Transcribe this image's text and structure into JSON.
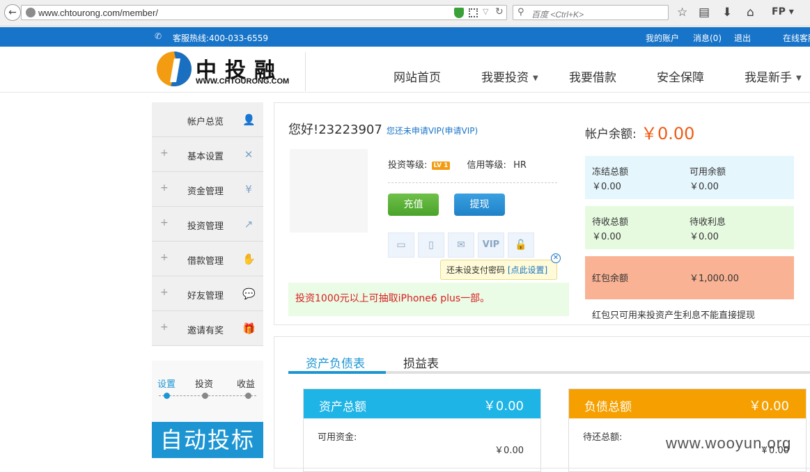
{
  "browser": {
    "url": "www.chtourong.com/member/",
    "search_placeholder": "百度 <Ctrl+K>",
    "profile": "FP"
  },
  "topbar": {
    "hotline": "客服热线:400-033-6559",
    "links": [
      "我的账户",
      "消息(0)",
      "退出",
      "在线客服"
    ]
  },
  "header": {
    "logo_text": "中投融",
    "logo_url": "WWW.CHTOURONG.COM",
    "nav": [
      "网站首页",
      "我要投资",
      "我要借款",
      "安全保障",
      "我是新手"
    ]
  },
  "sidebar": {
    "items": [
      {
        "label": "帐户总览",
        "icon": "users-icon",
        "expandable": false
      },
      {
        "label": "基本设置",
        "icon": "tools-icon",
        "expandable": true
      },
      {
        "label": "资金管理",
        "icon": "yen-icon",
        "expandable": true
      },
      {
        "label": "投资管理",
        "icon": "growth-chart-icon",
        "expandable": true
      },
      {
        "label": "借款管理",
        "icon": "hand-money-icon",
        "expandable": true
      },
      {
        "label": "好友管理",
        "icon": "chat-bubbles-icon",
        "expandable": true
      },
      {
        "label": "邀请有奖",
        "icon": "gift-icon",
        "expandable": true
      }
    ]
  },
  "auto_bid": {
    "steps": [
      "设置",
      "投资",
      "收益"
    ],
    "banner": "自动投标"
  },
  "account": {
    "greeting": "您好!23223907",
    "vip_link": "您还未申请VIP",
    "vip_apply": "(申请VIP)",
    "invest_level_label": "投资等级:",
    "invest_level_badge": "LV 1",
    "credit_level_label": "信用等级:",
    "credit_level_value": "HR",
    "recharge_label": "充值",
    "withdraw_label": "提现",
    "verify_icons": [
      "bank-card-icon",
      "mobile-phone-icon",
      "email-icon",
      "vip-icon",
      "unlock-icon"
    ],
    "vip_glyph": "VIP",
    "tooltip_text": "还未设支付密码",
    "tooltip_link": "[点此设置]",
    "promo": "投资1000元以上可抽取iPhone6 plus一部。"
  },
  "balance": {
    "label": "帐户余额:",
    "value": "￥0.00",
    "frozen_label": "冻结总额",
    "frozen_value": "￥0.00",
    "available_label": "可用余额",
    "available_value": "￥0.00",
    "pending_label": "待收总额",
    "pending_value": "￥0.00",
    "pending_interest_label": "待收利息",
    "pending_interest_value": "￥0.00",
    "redbag_label": "红包余额",
    "redbag_value": "￥1,000.00",
    "redbag_note": "红包只可用来投资产生利息不能直接提现"
  },
  "statements": {
    "tabs": [
      "资产负债表",
      "损益表"
    ],
    "assets": {
      "title": "资产总额",
      "amount": "￥0.00",
      "row_label": "可用资金:",
      "row_value": "￥0.00"
    },
    "liabilities": {
      "title": "负债总额",
      "amount": "￥0.00",
      "row_label": "待还总额:",
      "row_value": "￥0.00"
    }
  },
  "watermark": "www.wooyun.org",
  "colors": {
    "topbar": "#1874c8",
    "accent_orange": "#f05a14",
    "assets_header": "#1eb4e6",
    "liabilities_header": "#f5a000",
    "frozen_bg": "#e5f6fd",
    "pending_bg": "#e6fae0",
    "redbag_bg": "#f9b294"
  }
}
